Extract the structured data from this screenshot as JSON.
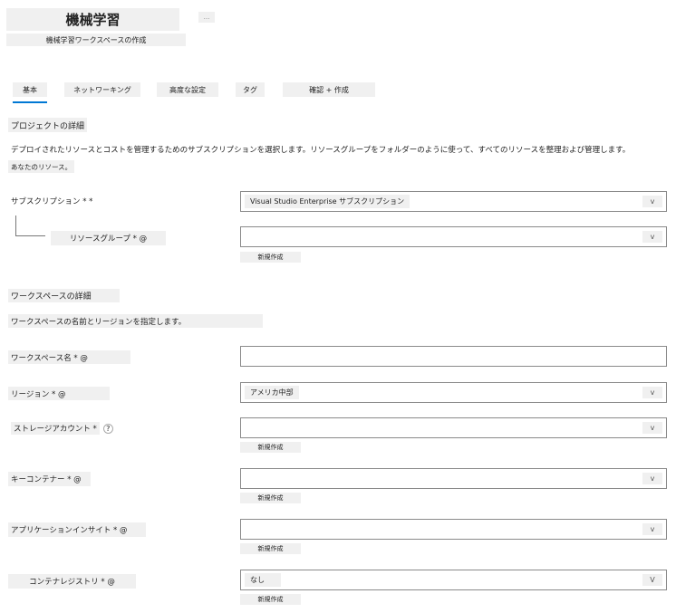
{
  "header": {
    "title": "機械学習",
    "subtitle": "機械学習ワークスペースの作成",
    "more_label": "..."
  },
  "tabs": [
    {
      "label": "基本",
      "active": true
    },
    {
      "label": "ネットワーキング",
      "active": false
    },
    {
      "label": "高度な設定",
      "active": false
    },
    {
      "label": "タグ",
      "active": false
    },
    {
      "label": "確認 + 作成",
      "active": false
    }
  ],
  "project": {
    "section_title": "プロジェクトの詳細",
    "description": "デプロイされたリソースとコストを管理するためのサブスクリプションを選択します。リソースグループをフォルダーのように使って、すべてのリソースを整理および管理します。",
    "description_link": "あなたのリソース。",
    "subscription": {
      "label": "サブスクリプション * *",
      "value": "Visual Studio Enterprise サブスクリプション",
      "chevron": "v"
    },
    "resource_group": {
      "label": "リソースグループ * @",
      "value": "",
      "chevron": "v",
      "new_label": "新規作成"
    }
  },
  "workspace": {
    "section_title": "ワークスペースの詳細",
    "description": "ワークスペースの名前とリージョンを指定します。",
    "name": {
      "label": "ワークスペース名 * @",
      "value": ""
    },
    "region": {
      "label": "リージョン * @",
      "value": "アメリカ中部",
      "chevron": "v"
    },
    "storage": {
      "label": "ストレージアカウント *",
      "help": "?",
      "value": "",
      "chevron": "v",
      "new_label": "新規作成"
    },
    "keyvault": {
      "label": "キーコンテナー * @",
      "value": "",
      "chevron": "v",
      "new_label": "新規作成"
    },
    "appinsights": {
      "label": "アプリケーションインサイト * @",
      "value": "",
      "chevron": "v",
      "new_label": "新規作成"
    },
    "registry": {
      "label": "コンテナレジストリ * @",
      "value": "なし",
      "chevron": "V",
      "new_label": "新規作成"
    }
  },
  "colors": {
    "accent": "#0078d4",
    "label_bg": "#f0f0f0",
    "border": "#8a8a8a"
  }
}
